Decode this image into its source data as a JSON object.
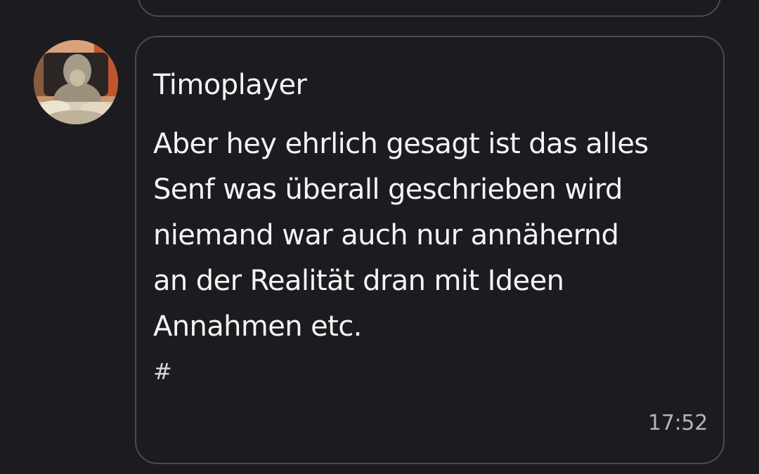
{
  "previous_message": {},
  "message": {
    "author": "Timoplayer",
    "lines": [
      "Aber hey ehrlich gesagt ist das alles",
      "Senf was überall geschrieben wird",
      "niemand war auch nur annähernd",
      "an der Realität dran mit Ideen",
      "Annahmen etc."
    ],
    "hashtag_symbol": "#",
    "time": "17:52"
  },
  "colors": {
    "background": "#1c1c20",
    "bubble_border": "#4a4a4f",
    "text": "#f4f4f4",
    "timestamp": "#b4b4b8"
  },
  "icons": {
    "avatar": "user-avatar-photo"
  }
}
